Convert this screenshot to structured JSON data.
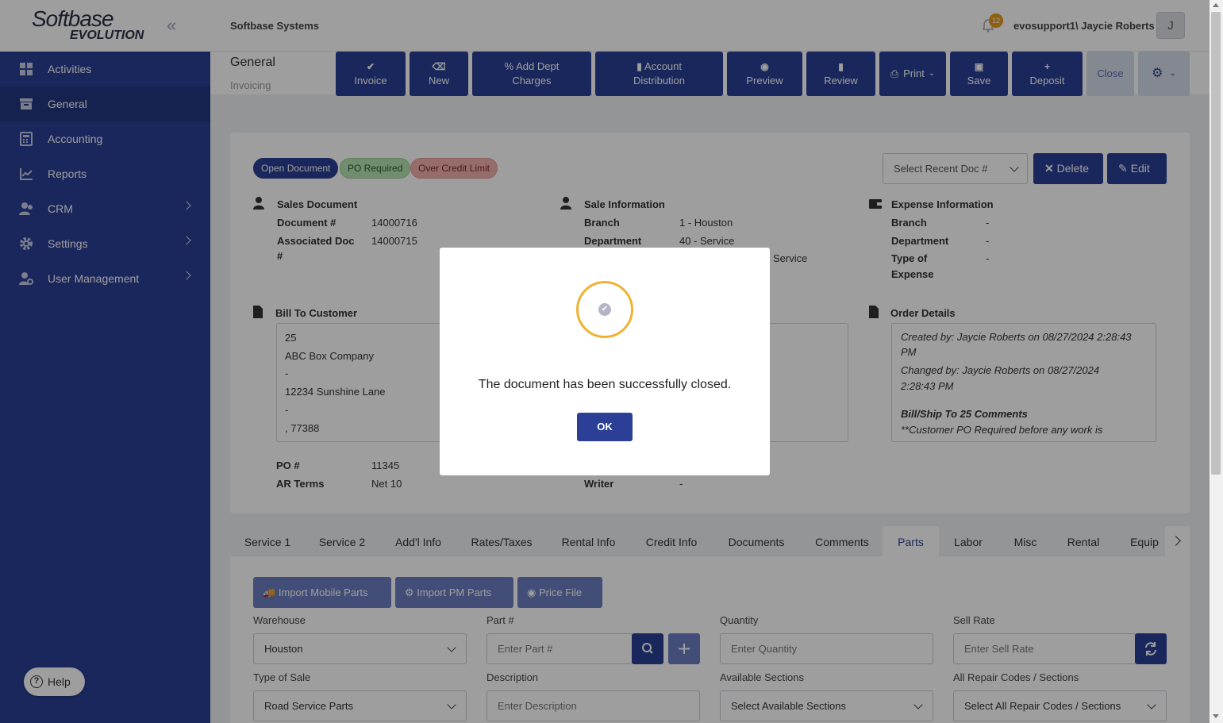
{
  "app": {
    "logo_line1": "Softbase",
    "logo_line2": "EVOLUTION",
    "company": "Softbase Systems",
    "notification_count": "12",
    "user": "evosupport1\\ Jaycie Roberts",
    "avatar_initial": "J",
    "help_label": "Help"
  },
  "sidebar": {
    "items": [
      {
        "label": "Activities",
        "icon": "grid-icon"
      },
      {
        "label": "General",
        "icon": "archive-icon"
      },
      {
        "label": "Accounting",
        "icon": "calculator-icon"
      },
      {
        "label": "Reports",
        "icon": "chart-icon"
      },
      {
        "label": "CRM",
        "icon": "users-icon"
      },
      {
        "label": "Settings",
        "icon": "gear-icon"
      },
      {
        "label": "User Management",
        "icon": "user-gear-icon"
      }
    ]
  },
  "page": {
    "title": "General",
    "subtitle": "Invoicing"
  },
  "toolbar": {
    "invoice": "Invoice",
    "new": "New",
    "add_dept_charges_1": "Add Dept",
    "add_dept_charges_2": "Charges",
    "account_distribution_1": "Account",
    "account_distribution_2": "Distribution",
    "preview": "Preview",
    "review": "Review",
    "print": "Print",
    "save": "Save",
    "deposit": "Deposit",
    "close": "Close"
  },
  "badges": {
    "open": "Open Document",
    "po": "PO Required",
    "credit": "Over Credit Limit"
  },
  "recent_doc": {
    "placeholder": "Select Recent Doc #"
  },
  "actions": {
    "delete": "Delete",
    "edit": "Edit"
  },
  "sales_document": {
    "heading": "Sales Document",
    "doc_label": "Document #",
    "doc_value": "14000716",
    "assoc_label_1": "Associated Doc",
    "assoc_label_2": "#",
    "assoc_value": "14000715"
  },
  "sale_information": {
    "heading": "Sale Information",
    "branch_label": "Branch",
    "branch_value": "1 - Houston",
    "dept_label": "Department",
    "dept_value": "40 - Service",
    "partial_value": "Service"
  },
  "expense_information": {
    "heading": "Expense Information",
    "branch_label": "Branch",
    "branch_value": "-",
    "dept_label": "Department",
    "dept_value": "-",
    "type_label_1": "Type of",
    "type_label_2": "Expense",
    "type_value": "-"
  },
  "bill_to": {
    "heading": "Bill To Customer",
    "lines": [
      "25",
      "ABC Box Company",
      "-",
      "12234 Sunshine Lane",
      "-",
      ", 77388"
    ]
  },
  "order_details": {
    "heading": "Order Details",
    "created_1": "Created by: Jaycie Roberts on 08/27/2024 2:28:43",
    "created_2": "PM",
    "changed_1": "Changed by: Jaycie Roberts on 08/27/2024",
    "changed_2": "2:28:43 PM",
    "comments_heading": "Bill/Ship To 25 Comments",
    "comment_1": "**Customer PO Required before any work is"
  },
  "po": {
    "label": "PO #",
    "value": "11345"
  },
  "ar_terms": {
    "label": "AR Terms",
    "value": "Net 10"
  },
  "writer": {
    "label": "Writer",
    "value": "-"
  },
  "tabs": [
    "Service 1",
    "Service 2",
    "Add'l Info",
    "Rates/Taxes",
    "Rental Info",
    "Credit Info",
    "Documents",
    "Comments",
    "Parts",
    "Labor",
    "Misc",
    "Rental",
    "Equip"
  ],
  "parts": {
    "import_mobile": "Import Mobile Parts",
    "import_pm": "Import PM Parts",
    "price_file": "Price File",
    "warehouse_label": "Warehouse",
    "warehouse_value": "Houston",
    "part_label": "Part #",
    "part_placeholder": "Enter Part #",
    "quantity_label": "Quantity",
    "quantity_placeholder": "Enter Quantity",
    "sell_rate_label": "Sell Rate",
    "sell_rate_placeholder": "Enter Sell Rate",
    "type_of_sale_label": "Type of Sale",
    "type_of_sale_value": "Road Service Parts",
    "description_label": "Description",
    "description_placeholder": "Enter Description",
    "available_sections_label": "Available Sections",
    "available_sections_value": "Select Available Sections",
    "repair_codes_label": "All Repair Codes / Sections",
    "repair_codes_value": "Select All Repair Codes / Sections"
  },
  "modal": {
    "message": "The document has been successfully closed.",
    "ok": "OK"
  },
  "colors": {
    "primary": "#2a3f95",
    "sidebar": "#2a3f95",
    "warning_ring": "#f0b232"
  }
}
